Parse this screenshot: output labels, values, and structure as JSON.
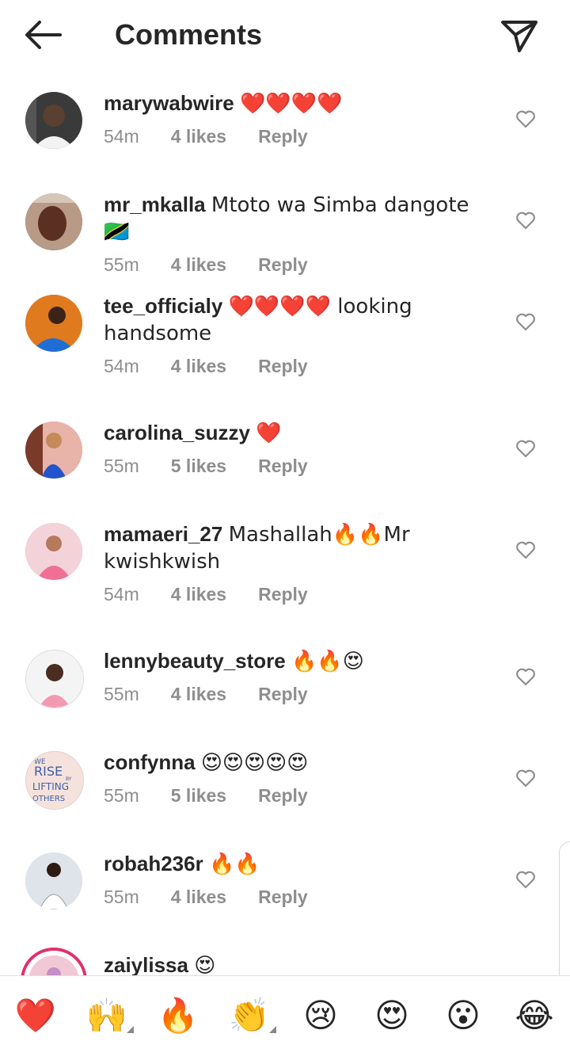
{
  "header": {
    "title": "Comments"
  },
  "comments": [
    {
      "username": "marywabwire",
      "text": "❤️❤️❤️❤️",
      "time": "54m",
      "likes": "4 likes",
      "reply": "Reply",
      "avatar_color": "#3a3a3a"
    },
    {
      "username": "mr_mkalla",
      "text": "Mtoto wa Simba dangote 🇹🇿",
      "time": "55m",
      "likes": "4 likes",
      "reply": "Reply",
      "avatar_color": "#6e3b2a"
    },
    {
      "username": "tee_officialy",
      "text": "❤️❤️❤️❤️ looking handsome",
      "time": "54m",
      "likes": "4 likes",
      "reply": "Reply",
      "avatar_color": "#e07a1f"
    },
    {
      "username": "carolina_suzzy",
      "text": "❤️",
      "time": "55m",
      "likes": "5 likes",
      "reply": "Reply",
      "avatar_color": "#c9667c"
    },
    {
      "username": "mamaeri_27",
      "text": "Mashallah🔥🔥Mr kwishkwish",
      "time": "54m",
      "likes": "4 likes",
      "reply": "Reply",
      "avatar_color": "#e8a4b4"
    },
    {
      "username": "lennybeauty_store",
      "text": "🔥🔥😍",
      "time": "55m",
      "likes": "4 likes",
      "reply": "Reply",
      "avatar_color": "#efefef"
    },
    {
      "username": "confynna",
      "text": "😍😍😍😍😍",
      "time": "55m",
      "likes": "5 likes",
      "reply": "Reply",
      "avatar_color": "#f6e2dc"
    },
    {
      "username": "robah236r",
      "text": "🔥🔥",
      "time": "55m",
      "likes": "4 likes",
      "reply": "Reply",
      "avatar_color": "#d9dde3"
    },
    {
      "username": "zaiylissa",
      "text": "😍",
      "time": "",
      "likes": "",
      "reply": "",
      "avatar_color": "#f1c8d6"
    }
  ],
  "avatar_art": {
    "confynna_lines": [
      "WE",
      "RISE",
      "BY",
      "LIFTING",
      "OTHERS"
    ]
  },
  "reactions": [
    {
      "emoji": "❤️",
      "name": "red-heart"
    },
    {
      "emoji": "🙌",
      "name": "raising-hands"
    },
    {
      "emoji": "🔥",
      "name": "fire"
    },
    {
      "emoji": "👏",
      "name": "clapping-hands"
    },
    {
      "emoji": "😢",
      "name": "crying-face"
    },
    {
      "emoji": "😍",
      "name": "heart-eyes"
    },
    {
      "emoji": "😮",
      "name": "open-mouth"
    },
    {
      "emoji": "😂",
      "name": "tears-of-joy"
    }
  ],
  "colors": {
    "text": "#262626",
    "meta": "#8e8e8e",
    "accent_heart": "#ed1c24"
  }
}
